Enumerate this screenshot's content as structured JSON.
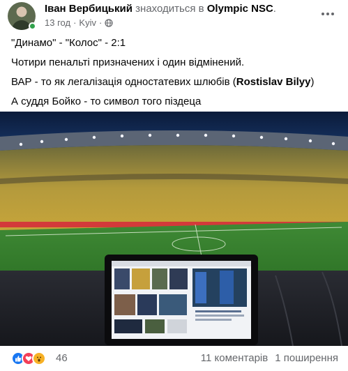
{
  "post": {
    "author": "Іван Вербицький",
    "checkin_text": "знаходиться в",
    "place": "Olympic NSC",
    "place_suffix": ".",
    "time": "13 год",
    "separator": "·",
    "location": "Kyiv",
    "visibility_icon": "globe-icon",
    "more_icon": "more-options-icon"
  },
  "text": {
    "line1": "\"Динамо\" - \"Колос\" - 2:1",
    "line2": "Чотири пенальті призначених і один відмінений.",
    "line3_before": "ВАР - то як легалізація одностатевих шлюбів (",
    "line3_mention": "Rostislav Bilyy",
    "line3_after": ")",
    "line4": "А суддя Бойко - то символ того піздеца"
  },
  "reactions": {
    "icons": [
      "like-icon",
      "love-icon",
      "wow-icon"
    ],
    "colors": {
      "like": "#1877f2",
      "love": "#f33e58",
      "wow": "#f7b125"
    },
    "count": "46",
    "comments": "11 коментарів",
    "shares": "1 поширення"
  }
}
